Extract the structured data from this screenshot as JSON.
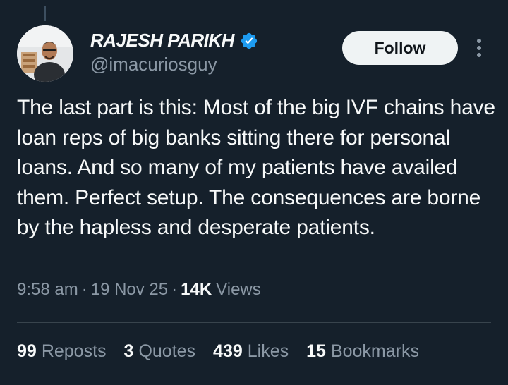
{
  "author": {
    "display_name": "RAJESH PARIKH",
    "handle": "@imacuriosguy",
    "verified_icon": "verified-badge-icon"
  },
  "actions": {
    "follow_label": "Follow",
    "more_icon": "more-vertical-icon"
  },
  "tweet": {
    "text": "The last part is this: Most of the big IVF chains have loan reps of big banks sitting there for personal loans. And so many of my patients have availed them. Perfect setup. The consequences are borne by the hapless and desperate patients.",
    "time": "9:58 am",
    "separator": "·",
    "date": "19 Nov 25",
    "views_count": "14K",
    "views_label": "Views"
  },
  "stats": [
    {
      "count": "99",
      "label": "Reposts"
    },
    {
      "count": "3",
      "label": "Quotes"
    },
    {
      "count": "439",
      "label": "Likes"
    },
    {
      "count": "15",
      "label": "Bookmarks"
    }
  ],
  "colors": {
    "background": "#15202b",
    "text_primary": "#f7f9f9",
    "text_secondary": "#8b98a5",
    "verified": "#1d9bf0",
    "follow_bg": "#eff3f4"
  }
}
